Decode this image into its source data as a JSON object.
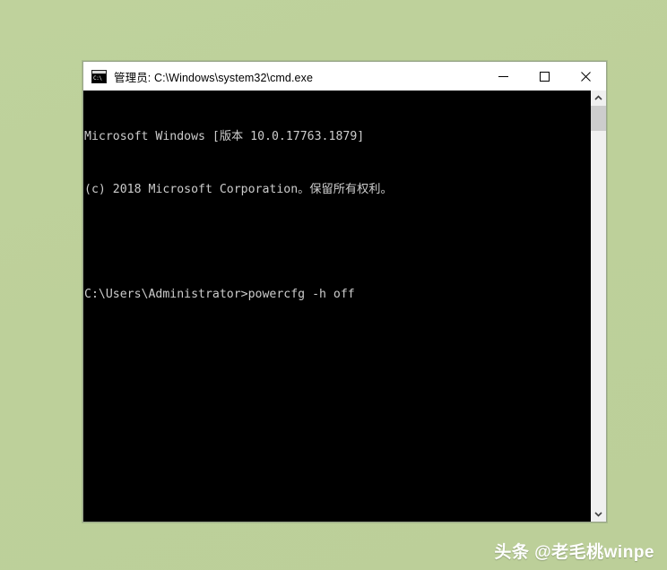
{
  "desktop": {
    "background_color": "#bfd19b"
  },
  "window": {
    "title": "管理员: C:\\Windows\\system32\\cmd.exe",
    "icon_name": "cmd-icon",
    "icon_text": "C:\\",
    "controls": {
      "minimize_label": "最小化",
      "maximize_label": "最大化",
      "close_label": "关闭"
    }
  },
  "console": {
    "background_color": "#000000",
    "text_color": "#cccccc",
    "lines": [
      "Microsoft Windows [版本 10.0.17763.1879]",
      "(c) 2018 Microsoft Corporation。保留所有权利。",
      "",
      "C:\\Users\\Administrator>powercfg -h off"
    ],
    "scrollbar": {
      "up_arrow": "▲",
      "down_arrow": "▼"
    }
  },
  "watermark": {
    "text": "头条 @老毛桃winpe"
  }
}
